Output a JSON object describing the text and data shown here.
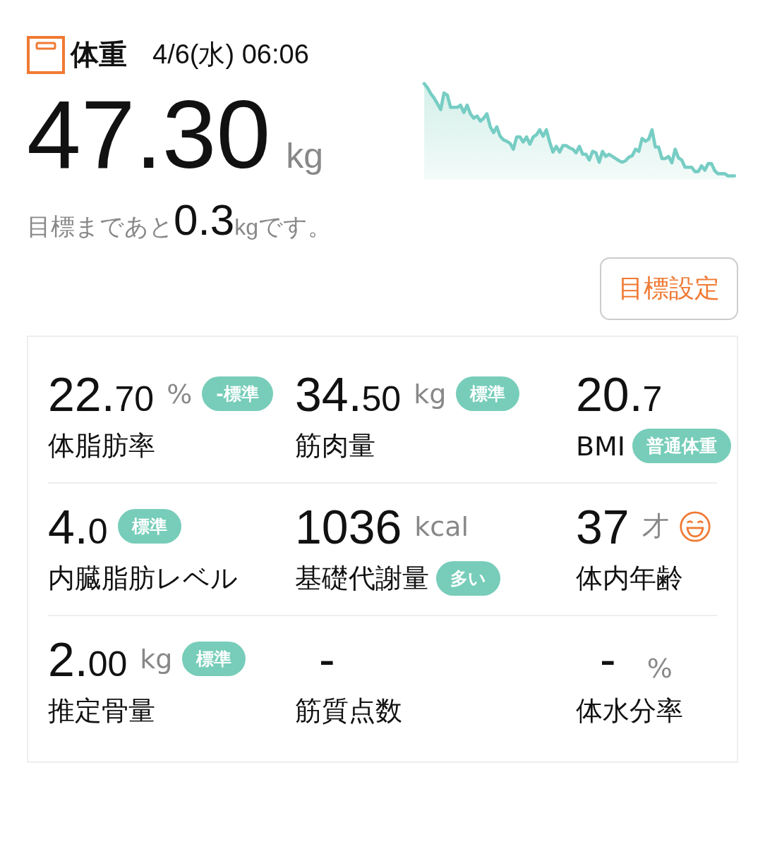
{
  "header": {
    "title": "体重",
    "datetime": "4/6(水) 06:06"
  },
  "weight": {
    "value": "47.30",
    "unit": "kg"
  },
  "goal": {
    "prefix": "目標まであと",
    "value": "0.3",
    "unit": "kg",
    "suffix": "です。"
  },
  "goal_button": "目標設定",
  "metrics": [
    {
      "kind": "top-badge",
      "main": "22.",
      "decimal": "70",
      "unit": "%",
      "badge": "-標準",
      "label": "体脂肪率"
    },
    {
      "kind": "top-badge",
      "main": "34.",
      "decimal": "50",
      "unit": "kg",
      "badge": "標準",
      "label": "筋肉量"
    },
    {
      "kind": "label-badge",
      "main": "20.",
      "decimal": "7",
      "badge": "普通体重",
      "label": "BMI"
    },
    {
      "kind": "top-badge",
      "main": "4.",
      "decimal": "0",
      "badge": "標準",
      "label": "内臓脂肪レベル"
    },
    {
      "kind": "label-badge",
      "main": "1036",
      "unit": "kcal",
      "badge": "多い",
      "label": "基礎代謝量"
    },
    {
      "kind": "face",
      "main": "37",
      "unit": "才",
      "label": "体内年齢"
    },
    {
      "kind": "top-badge",
      "main": "2.",
      "decimal": "00",
      "unit": "kg",
      "badge": "標準",
      "label": "推定骨量"
    },
    {
      "kind": "empty",
      "main": "-",
      "label": "筋質点数"
    },
    {
      "kind": "empty",
      "main": "-",
      "unit": "%",
      "label": "体水分率"
    }
  ]
}
